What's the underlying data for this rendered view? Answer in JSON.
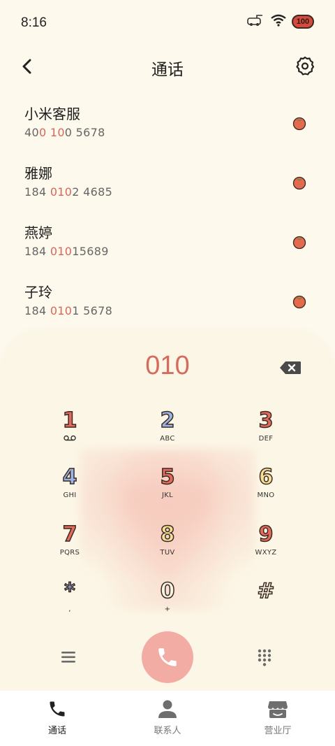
{
  "status": {
    "time": "8:16",
    "battery": "100"
  },
  "header": {
    "title": "通话"
  },
  "contacts": [
    {
      "name": "小米客服",
      "num_pre": "40",
      "num_hl": "0 10",
      "num_post": "0 5678"
    },
    {
      "name": "雅娜",
      "num_pre": "184 ",
      "num_hl": "010",
      "num_post": "2 4685"
    },
    {
      "name": "燕婷",
      "num_pre": "184 ",
      "num_hl": "010",
      "num_post": "15689"
    },
    {
      "name": "子玲",
      "num_pre": "184 ",
      "num_hl": "010",
      "num_post": "1 5678"
    }
  ],
  "dialer": {
    "display": "010"
  },
  "keys": [
    {
      "digit": "1",
      "sub": "",
      "color": "#e36a5c"
    },
    {
      "digit": "2",
      "sub": "ABC",
      "color": "#9bb4e6"
    },
    {
      "digit": "3",
      "sub": "DEF",
      "color": "#e36a5c"
    },
    {
      "digit": "4",
      "sub": "GHI",
      "color": "#9bb4e6"
    },
    {
      "digit": "5",
      "sub": "JKL",
      "color": "#e36a5c"
    },
    {
      "digit": "6",
      "sub": "MNO",
      "color": "#f3df96"
    },
    {
      "digit": "7",
      "sub": "PQRS",
      "color": "#e36a5c"
    },
    {
      "digit": "8",
      "sub": "TUV",
      "color": "#f3df96"
    },
    {
      "digit": "9",
      "sub": "WXYZ",
      "color": "#e36a5c"
    },
    {
      "digit": "*",
      "sub": ",",
      "color": "#9bb4e6"
    },
    {
      "digit": "0",
      "sub": "+",
      "color": "#f7f2e4"
    },
    {
      "digit": "#",
      "sub": "",
      "color": "#f7f2e4"
    }
  ],
  "nav": {
    "calls": "通话",
    "contacts": "联系人",
    "store": "营业厅"
  },
  "colors": {
    "accent": "#d46b5d",
    "call_button": "#f2aca4",
    "background": "#fdf9ec"
  }
}
